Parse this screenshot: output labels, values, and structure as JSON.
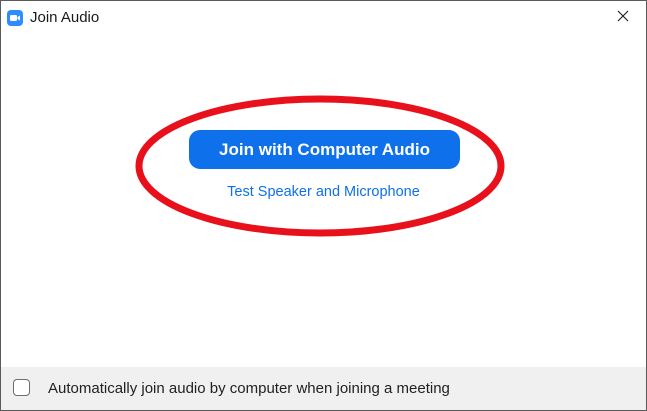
{
  "window": {
    "title": "Join Audio",
    "app_icon": "zoom-camera-icon",
    "close_icon": "close-icon"
  },
  "main": {
    "join_button_label": "Join with Computer Audio",
    "test_link_label": "Test Speaker and Microphone",
    "annotation": "red-ellipse-highlight"
  },
  "footer": {
    "auto_join_label": "Automatically join audio by computer when joining a meeting",
    "auto_join_checked": false
  },
  "colors": {
    "accent": "#0e71eb",
    "highlight": "#e8101b",
    "footer_bg": "#f0f0f0"
  }
}
